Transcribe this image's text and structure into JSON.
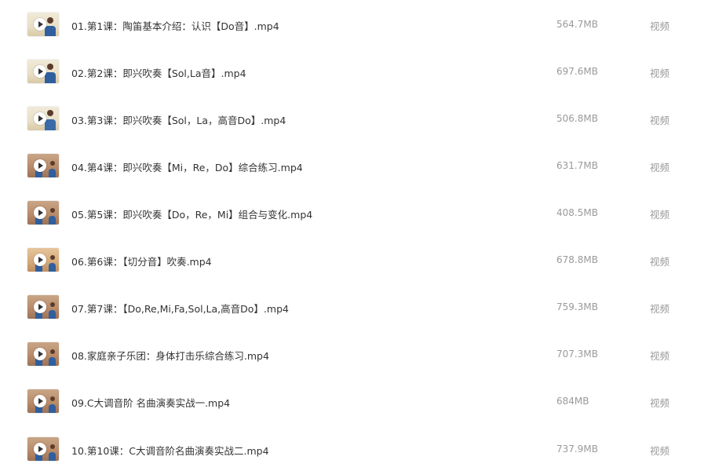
{
  "files": [
    {
      "name": "01.第1课：陶笛基本介绍：认识【Do音】.mp4",
      "size": "564.7MB",
      "type": "视频"
    },
    {
      "name": "02.第2课：即兴吹奏【Sol,La音】.mp4",
      "size": "697.6MB",
      "type": "视频"
    },
    {
      "name": "03.第3课：即兴吹奏【Sol，La，高音Do】.mp4",
      "size": "506.8MB",
      "type": "视频"
    },
    {
      "name": "04.第4课：即兴吹奏【Mi，Re，Do】综合练习.mp4",
      "size": "631.7MB",
      "type": "视频"
    },
    {
      "name": "05.第5课：即兴吹奏【Do，Re，Mi】组合与变化.mp4",
      "size": "408.5MB",
      "type": "视频"
    },
    {
      "name": "06.第6课：【切分音】吹奏.mp4",
      "size": "678.8MB",
      "type": "视频"
    },
    {
      "name": "07.第7课：【Do,Re,Mi,Fa,Sol,La,高音Do】.mp4",
      "size": "759.3MB",
      "type": "视频"
    },
    {
      "name": "08.家庭亲子乐团：身体打击乐综合练习.mp4",
      "size": "707.3MB",
      "type": "视频"
    },
    {
      "name": "09.C大调音阶 名曲演奏实战一.mp4",
      "size": "684MB",
      "type": "视频"
    },
    {
      "name": "10.第10课：C大调音阶名曲演奏实战二.mp4",
      "size": "737.9MB",
      "type": "视频"
    }
  ],
  "icons": {
    "thumbnail": "video-thumbnail-icon",
    "play": "play-icon"
  }
}
